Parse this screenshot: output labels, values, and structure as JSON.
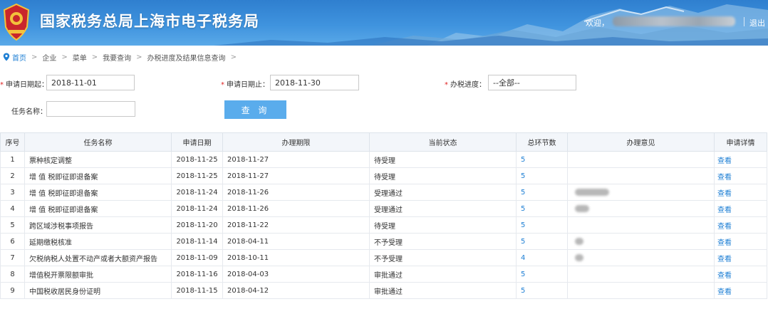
{
  "header": {
    "site_title": "国家税务总局上海市电子税务局",
    "welcome_label": "欢迎，",
    "logout_label": "退出",
    "emblem_icon": "tax-emblem-icon",
    "colors": {
      "banner": "#3f93de",
      "accent": "#1e7fd4"
    }
  },
  "breadcrumb": {
    "items": [
      "首页",
      "企业",
      "菜单",
      "我要查询",
      "办税进度及结果信息查询"
    ],
    "separator": ">"
  },
  "form": {
    "start_date": {
      "label": "申请日期起：",
      "value": "2018-11-01"
    },
    "end_date": {
      "label": "申请日期止：",
      "value": "2018-11-30"
    },
    "progress": {
      "label": "办税进度：",
      "value": "--全部--"
    },
    "task_name": {
      "label": "任务名称：",
      "value": ""
    },
    "query_button": "查 询"
  },
  "table": {
    "columns": [
      "序号",
      "任务名称",
      "申请日期",
      "办理期限",
      "当前状态",
      "总环节数",
      "办理意见",
      "申请详情"
    ],
    "rows": [
      {
        "no": "1",
        "name": "票种核定调整",
        "apply_date": "2018-11-25",
        "deadline": "2018-11-27",
        "status": "待受理",
        "steps": "5",
        "opinion_redacted": false,
        "detail": "查看"
      },
      {
        "no": "2",
        "name": "增 值 税即征即退备案",
        "apply_date": "2018-11-25",
        "deadline": "2018-11-27",
        "status": "待受理",
        "steps": "5",
        "opinion_redacted": false,
        "detail": "查看"
      },
      {
        "no": "3",
        "name": "增 值 税即征即退备案",
        "apply_date": "2018-11-24",
        "deadline": "2018-11-26",
        "status": "受理通过",
        "steps": "5",
        "opinion_redacted": true,
        "detail": "查看"
      },
      {
        "no": "4",
        "name": "增 值 税即征即退备案",
        "apply_date": "2018-11-24",
        "deadline": "2018-11-26",
        "status": "受理通过",
        "steps": "5",
        "opinion_redacted": true,
        "detail": "查看"
      },
      {
        "no": "5",
        "name": "跨区域涉税事项报告",
        "apply_date": "2018-11-20",
        "deadline": "2018-11-22",
        "status": "待受理",
        "steps": "5",
        "opinion_redacted": false,
        "detail": "查看"
      },
      {
        "no": "6",
        "name": "延期缴税核准",
        "apply_date": "2018-11-14",
        "deadline": "2018-04-11",
        "status": "不予受理",
        "steps": "5",
        "opinion_redacted": true,
        "detail": "查看"
      },
      {
        "no": "7",
        "name": "欠税纳税人处置不动产或者大额资产报告",
        "apply_date": "2018-11-09",
        "deadline": "2018-10-11",
        "status": "不予受理",
        "steps": "4",
        "opinion_redacted": true,
        "detail": "查看"
      },
      {
        "no": "8",
        "name": "增值税开票限额审批",
        "apply_date": "2018-11-16",
        "deadline": "2018-04-03",
        "status": "审批通过",
        "steps": "5",
        "opinion_redacted": false,
        "detail": "查看"
      },
      {
        "no": "9",
        "name": "中国税收居民身份证明",
        "apply_date": "2018-11-15",
        "deadline": "2018-04-12",
        "status": "审批通过",
        "steps": "5",
        "opinion_redacted": false,
        "detail": "查看"
      }
    ]
  }
}
